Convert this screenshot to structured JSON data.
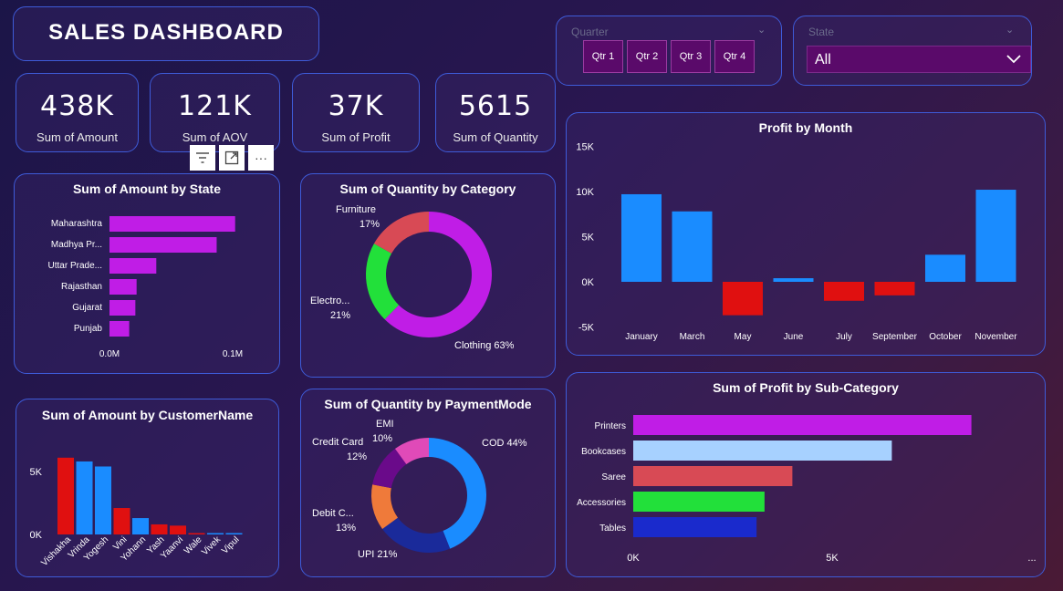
{
  "dashboard": {
    "title": "SALES  DASHBOARD"
  },
  "kpis": [
    {
      "value": "438K",
      "label": "Sum of Amount"
    },
    {
      "value": "121K",
      "label": "Sum of AOV"
    },
    {
      "value": "37K",
      "label": "Sum of Profit"
    },
    {
      "value": "5615",
      "label": "Sum of Quantity"
    }
  ],
  "slicers": {
    "quarter": {
      "header": "Quarter",
      "options": [
        "Qtr 1",
        "Qtr 2",
        "Qtr 3",
        "Qtr 4"
      ]
    },
    "state": {
      "header": "State",
      "selected": "All"
    }
  },
  "toolbar": {
    "filter_icon": "filter-icon",
    "focus_icon": "focus-mode-icon",
    "more_label": "···"
  },
  "colors": {
    "purple": "#c01de6",
    "blue": "#1a8cff",
    "red": "#e01010",
    "green": "#22e03a",
    "salmon": "#d84a55",
    "lightblue": "#a7d1ff",
    "navy": "#1a2acc",
    "orange": "#ef7a3a",
    "darkpurple": "#6a0a8a",
    "pink": "#e04ab8",
    "deepnavy": "#1a2a9a"
  },
  "chart_data": [
    {
      "id": "amount_by_state",
      "type": "bar",
      "orientation": "horizontal",
      "title": "Sum of Amount by State",
      "categories": [
        "Maharashtra",
        "Madhya Pr...",
        "Uttar Prade...",
        "Rajasthan",
        "Gujarat",
        "Punjab"
      ],
      "values": [
        102000,
        87000,
        38000,
        22000,
        21000,
        16000
      ],
      "xticks": [
        "0.0M",
        "0.1M"
      ],
      "xtick_values": [
        0,
        100000
      ]
    },
    {
      "id": "quantity_by_category",
      "type": "pie",
      "donut": true,
      "title": "Sum of Quantity by Category",
      "slices": [
        {
          "name": "Clothing",
          "value": 63,
          "label": "Clothing 63%"
        },
        {
          "name": "Electronics",
          "value": 21,
          "label_a": "Electro...",
          "label_b": "21%"
        },
        {
          "name": "Furniture",
          "value": 17,
          "label_a": "Furniture",
          "label_b": "17%"
        }
      ]
    },
    {
      "id": "profit_by_month",
      "type": "bar",
      "title": "Profit by Month",
      "categories": [
        "January",
        "March",
        "May",
        "June",
        "July",
        "September",
        "October",
        "November"
      ],
      "values": [
        9700,
        7800,
        -3700,
        400,
        -2100,
        -1500,
        3000,
        10200
      ],
      "yticks": [
        "15K",
        "10K",
        "5K",
        "0K",
        "-5K"
      ],
      "ytick_values": [
        15000,
        10000,
        5000,
        0,
        -5000
      ],
      "ylim": [
        -5000,
        15000
      ]
    },
    {
      "id": "amount_by_customer",
      "type": "bar",
      "title": "Sum of Amount by CustomerName",
      "categories": [
        "Vishakha",
        "Vrinda",
        "Yogesh",
        "Vini",
        "Yohann",
        "Yash",
        "Yaanvi",
        "Wale",
        "Vivek",
        "Vipul"
      ],
      "values": [
        6100,
        5800,
        5400,
        2100,
        1300,
        800,
        700,
        100,
        80,
        60
      ],
      "yticks": [
        "5K",
        "0K"
      ],
      "ytick_values": [
        5000,
        0
      ]
    },
    {
      "id": "quantity_by_paymentmode",
      "type": "pie",
      "donut": true,
      "title": "Sum of Quantity by PaymentMode",
      "slices": [
        {
          "name": "COD",
          "value": 44,
          "label": "COD 44%"
        },
        {
          "name": "UPI",
          "value": 21,
          "label": "UPI 21%"
        },
        {
          "name": "Debit Card",
          "value": 13,
          "label_a": "Debit C...",
          "label_b": "13%"
        },
        {
          "name": "Credit Card",
          "value": 12,
          "label_a": "Credit Card",
          "label_b": "12%"
        },
        {
          "name": "EMI",
          "value": 10,
          "label_a": "EMI",
          "label_b": "10%"
        }
      ]
    },
    {
      "id": "profit_by_subcategory",
      "type": "bar",
      "orientation": "horizontal",
      "title": "Sum of Profit by Sub-Category",
      "categories": [
        "Printers",
        "Bookcases",
        "Saree",
        "Accessories",
        "Tables"
      ],
      "values": [
        8500,
        6500,
        4000,
        3300,
        3100
      ],
      "xticks": [
        "0K",
        "5K"
      ],
      "xtick_values": [
        0,
        5000
      ],
      "more": "..."
    }
  ]
}
